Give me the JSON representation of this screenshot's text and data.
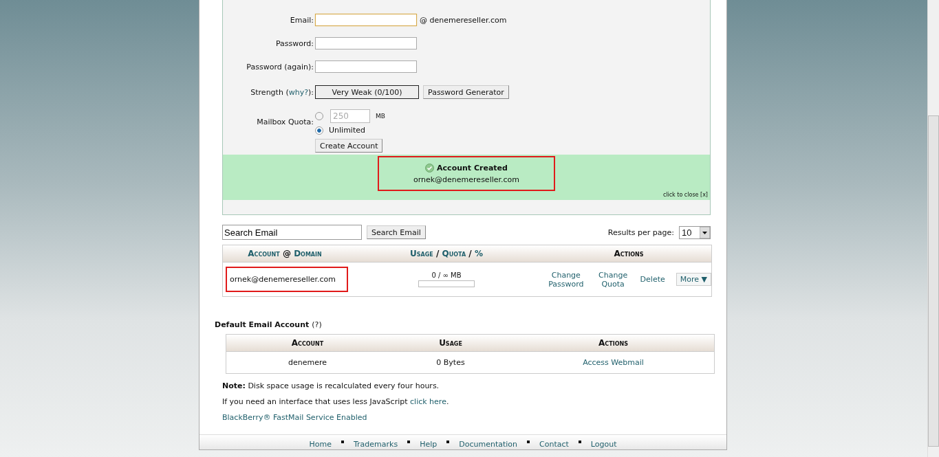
{
  "form": {
    "email": {
      "label": "Email:",
      "focused": true,
      "domain": "@ denemereseller.com"
    },
    "password": {
      "label": "Password:"
    },
    "password_again": {
      "label": "Password (again):"
    },
    "strength": {
      "label_before": "Strength (",
      "link": "why?",
      "label_after": "):",
      "meter": "Very Weak (0/100)",
      "generator_button": "Password Generator"
    },
    "quota": {
      "label": "Mailbox Quota:",
      "options": [
        {
          "kind": "amount",
          "value": "250",
          "unit": "MB",
          "selected": false
        },
        {
          "kind": "text",
          "label": "Unlimited",
          "selected": true
        }
      ]
    },
    "submit": "Create Account"
  },
  "notice": {
    "title": "Account Created",
    "detail": "ornek@denemereseller.com",
    "close": "click to close [x]",
    "highlighted": true
  },
  "search": {
    "value": "Search Email",
    "button": "Search Email",
    "per_page_label": "Results per page:",
    "per_page": "10"
  },
  "accounts": {
    "columns": [
      {
        "kind": "links",
        "parts": [
          "Account",
          "@",
          "Domain"
        ]
      },
      {
        "kind": "links",
        "parts": [
          "Usage",
          "/",
          "Quota",
          "/",
          "%"
        ]
      },
      {
        "kind": "plain",
        "parts": [
          "Actions"
        ]
      }
    ],
    "rows": [
      {
        "account": "ornek@denemereseller.com",
        "highlighted": true,
        "usage": "0 / ∞ MB",
        "level": 0,
        "actions": [
          "Change Password",
          "Change Quota",
          "Delete"
        ],
        "more": "More ▼"
      }
    ]
  },
  "default_account": {
    "title": "Default Email Account",
    "help": "(?)",
    "columns": [
      "Account",
      "Usage",
      "Actions"
    ],
    "row": {
      "account": "denemere",
      "usage": "0 Bytes",
      "action": "Access Webmail"
    }
  },
  "note": {
    "label": "Note:",
    "text": " Disk space usage is recalculated every four hours."
  },
  "js_note": {
    "text": "If you need an interface that uses less JavaScript ",
    "link": "click here",
    "after": "."
  },
  "blackberry": "BlackBerry® FastMail Service Enabled",
  "footer": [
    "Home",
    "Trademarks",
    "Help",
    "Documentation",
    "Contact",
    "Logout"
  ]
}
